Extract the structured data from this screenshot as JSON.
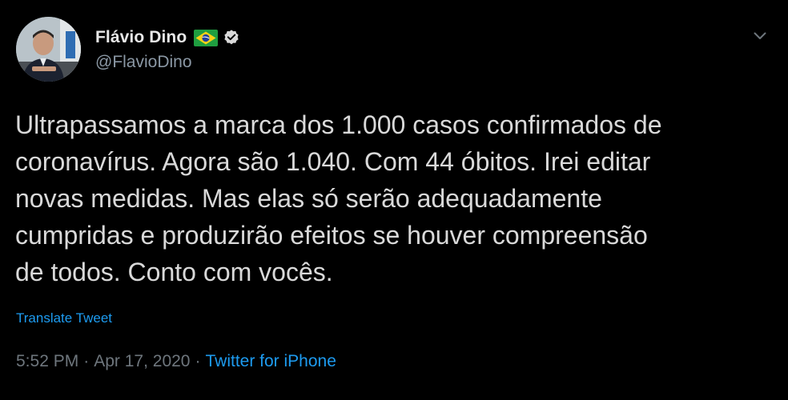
{
  "author": {
    "display_name": "Flávio Dino",
    "handle": "@FlavioDino"
  },
  "icons": {
    "flag": "brazil-flag-emoji",
    "verified": "verified-badge-icon",
    "more": "chevron-down-icon"
  },
  "tweet": {
    "lines": [
      "Ultrapassamos a marca dos 1.000 casos confirmados de",
      "coronavírus. Agora são 1.040. Com 44 óbitos. Irei editar",
      "novas medidas. Mas elas só serão adequadamente",
      "cumpridas e produzirão efeitos se houver compreensão",
      "de todos. Conto com vocês."
    ],
    "translate_label": "Translate Tweet"
  },
  "meta": {
    "time": "5:52 PM",
    "separator": "·",
    "date": "Apr 17, 2020",
    "source": "Twitter for iPhone"
  },
  "colors": {
    "background": "#000000",
    "text": "#d9d9d9",
    "secondary": "#6e767d",
    "link": "#1d9bf0"
  }
}
